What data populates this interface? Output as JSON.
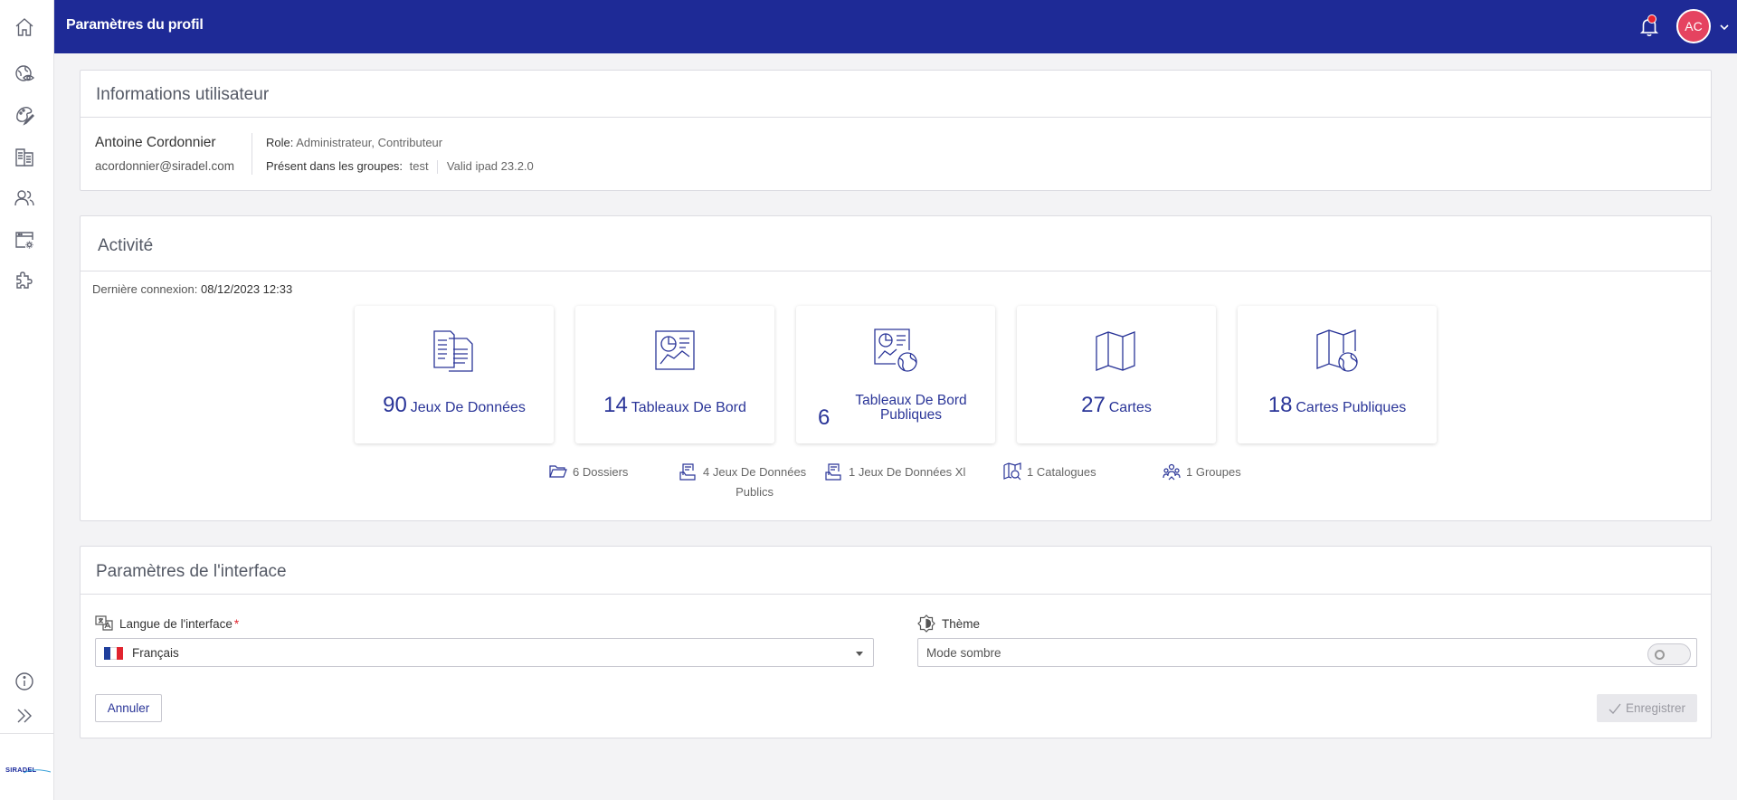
{
  "header": {
    "title": "Paramètres du profil"
  },
  "user": {
    "initials": "AC"
  },
  "nav": {
    "items": [
      {
        "icon": "home-icon"
      },
      {
        "icon": "globe-eye-icon"
      },
      {
        "icon": "pencil-palette-icon"
      },
      {
        "icon": "documents-icon"
      },
      {
        "icon": "users-icon"
      },
      {
        "icon": "calendar-gear-icon"
      },
      {
        "icon": "puzzle-icon"
      }
    ],
    "bottom": [
      {
        "icon": "info-icon"
      },
      {
        "icon": "expand-icon"
      }
    ],
    "logo": "SIRADEL"
  },
  "user_info": {
    "title": "Informations utilisateur",
    "name": "Antoine Cordonnier",
    "email": "acordonnier@siradel.com",
    "role_label": "Role:",
    "role_value": "Administrateur, Contributeur",
    "groups_label": "Présent dans les groupes:",
    "groups": [
      "test",
      "Valid ipad 23.2.0"
    ]
  },
  "activity": {
    "title": "Activité",
    "last_connection_label": "Dernière connexion:",
    "last_connection_value": "08/12/2023 12:33",
    "cards": [
      {
        "count": "90",
        "label": "Jeux De Données",
        "icon": "datasets-icon"
      },
      {
        "count": "14",
        "label": "Tableaux De Bord",
        "icon": "dashboard-icon"
      },
      {
        "count": "6",
        "label_line1": "Tableaux De Bord",
        "label_line2": "Publiques",
        "icon": "public-dashboard-icon"
      },
      {
        "count": "27",
        "label": "Cartes",
        "icon": "map-icon"
      },
      {
        "count": "18",
        "label": "Cartes Publiques",
        "icon": "public-map-icon"
      }
    ],
    "minis": [
      {
        "text": "6 Dossiers",
        "icon": "folder-icon"
      },
      {
        "text_line1": "4 Jeux De Données",
        "text_line2": "Publics",
        "icon": "public-datasets-icon"
      },
      {
        "text": "1 Jeux De Données Xl",
        "icon": "xl-datasets-icon"
      },
      {
        "text": "1 Catalogues",
        "icon": "catalog-icon"
      },
      {
        "text": "1 Groupes",
        "icon": "groups-icon"
      }
    ]
  },
  "interface": {
    "title": "Paramètres de l'interface",
    "language_label": "Langue de l'interface",
    "required_mark": "*",
    "language_value": "Français",
    "flag_colors": [
      "#1f3f9c",
      "#ffffff",
      "#e1242f"
    ],
    "theme_label": "Thème",
    "theme_option": "Mode sombre",
    "dark_mode": false,
    "cancel_label": "Annuler",
    "save_label": "Enregistrer"
  },
  "colors": {
    "primary": "#1e2a96",
    "avatar": "#e54360",
    "notification": "#e8232f"
  }
}
